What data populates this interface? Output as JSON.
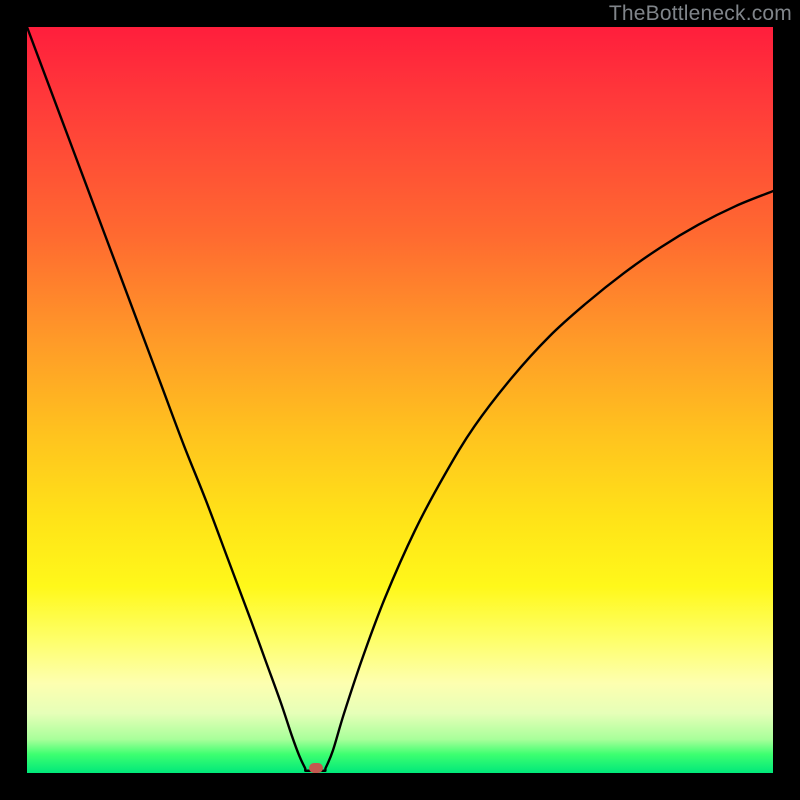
{
  "watermark": "TheBottleneck.com",
  "chart_data": {
    "type": "line",
    "title": "",
    "xlabel": "",
    "ylabel": "",
    "xlim": [
      0,
      100
    ],
    "ylim": [
      0,
      100
    ],
    "grid": false,
    "legend": false,
    "curve_left": [
      {
        "x": 0.0,
        "y": 100.0
      },
      {
        "x": 3.0,
        "y": 92.0
      },
      {
        "x": 6.0,
        "y": 84.0
      },
      {
        "x": 9.0,
        "y": 76.0
      },
      {
        "x": 12.0,
        "y": 68.0
      },
      {
        "x": 15.0,
        "y": 60.0
      },
      {
        "x": 18.0,
        "y": 52.0
      },
      {
        "x": 21.0,
        "y": 44.0
      },
      {
        "x": 24.0,
        "y": 36.5
      },
      {
        "x": 27.0,
        "y": 28.5
      },
      {
        "x": 30.0,
        "y": 20.5
      },
      {
        "x": 32.0,
        "y": 15.0
      },
      {
        "x": 34.0,
        "y": 9.5
      },
      {
        "x": 35.5,
        "y": 5.0
      },
      {
        "x": 36.5,
        "y": 2.3
      },
      {
        "x": 37.3,
        "y": 0.6
      }
    ],
    "curve_right": [
      {
        "x": 40.0,
        "y": 0.6
      },
      {
        "x": 41.0,
        "y": 3.0
      },
      {
        "x": 42.5,
        "y": 8.0
      },
      {
        "x": 45.0,
        "y": 15.5
      },
      {
        "x": 48.0,
        "y": 23.5
      },
      {
        "x": 52.0,
        "y": 32.5
      },
      {
        "x": 56.0,
        "y": 40.0
      },
      {
        "x": 60.0,
        "y": 46.5
      },
      {
        "x": 65.0,
        "y": 53.0
      },
      {
        "x": 70.0,
        "y": 58.5
      },
      {
        "x": 75.0,
        "y": 63.0
      },
      {
        "x": 80.0,
        "y": 67.0
      },
      {
        "x": 85.0,
        "y": 70.5
      },
      {
        "x": 90.0,
        "y": 73.5
      },
      {
        "x": 95.0,
        "y": 76.0
      },
      {
        "x": 100.0,
        "y": 78.0
      }
    ],
    "bottom_flat": {
      "from_x": 37.3,
      "to_x": 40.0,
      "y": 0.3
    },
    "marker": {
      "x": 38.8,
      "y": 0.7,
      "color": "#c3584f"
    }
  }
}
